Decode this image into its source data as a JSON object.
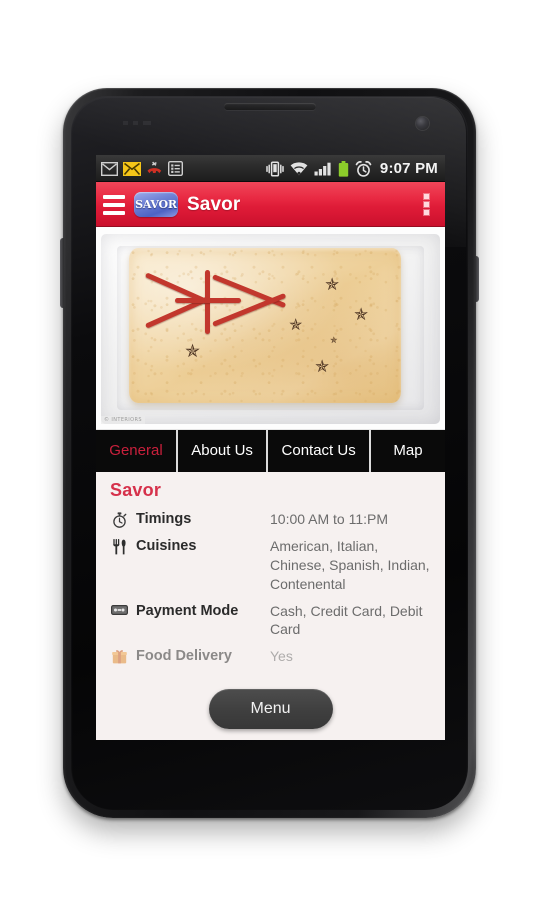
{
  "device": {
    "name": "android-smartphone"
  },
  "status_bar": {
    "icons": [
      "gmail-icon",
      "sms-message-icon",
      "missed-call-icon",
      "calendar-event-icon",
      "vibrate-mode-icon",
      "wifi-signal-icon",
      "cellular-signal-icon",
      "battery-full-icon",
      "alarm-clock-icon"
    ],
    "clock": "9:07 PM"
  },
  "action_bar": {
    "drawer_icon": "hamburger-menu-icon",
    "logo_text": "SAVOR",
    "title": "Savor",
    "overflow_icon": "overflow-menu-icon"
  },
  "hero": {
    "alt": "pastry shaped like the australian flag on a white plate",
    "watermark": "© INTERIORS"
  },
  "tabs": [
    {
      "id": "general",
      "label": "General",
      "active": true
    },
    {
      "id": "about-us",
      "label": "About Us",
      "active": false
    },
    {
      "id": "contact-us",
      "label": "Contact Us",
      "active": false
    },
    {
      "id": "map",
      "label": "Map",
      "active": false
    }
  ],
  "content": {
    "section_title": "Savor",
    "rows": [
      {
        "icon": "stopwatch-icon",
        "label": "Timings",
        "value": "10:00 AM to 11:PM"
      },
      {
        "icon": "cutlery-icon",
        "label": "Cuisines",
        "value": "American, Italian, Chinese, Spanish, Indian, Contenental"
      },
      {
        "icon": "banknote-icon",
        "label": "Payment Mode",
        "value": "Cash, Credit Card, Debit Card"
      },
      {
        "icon": "gift-box-icon",
        "label": "Food Delivery",
        "value": "Yes"
      }
    ]
  },
  "menu_button": {
    "label": "Menu"
  },
  "colors": {
    "accent_red": "#d81734",
    "title_red": "#d6314b",
    "tab_active_red": "#c9203c",
    "content_bg": "#f6f1f0",
    "tab_bg": "#0a0a0a",
    "logo_blue": "#4d63c4",
    "menu_button_gray": "#3f3f3f"
  }
}
